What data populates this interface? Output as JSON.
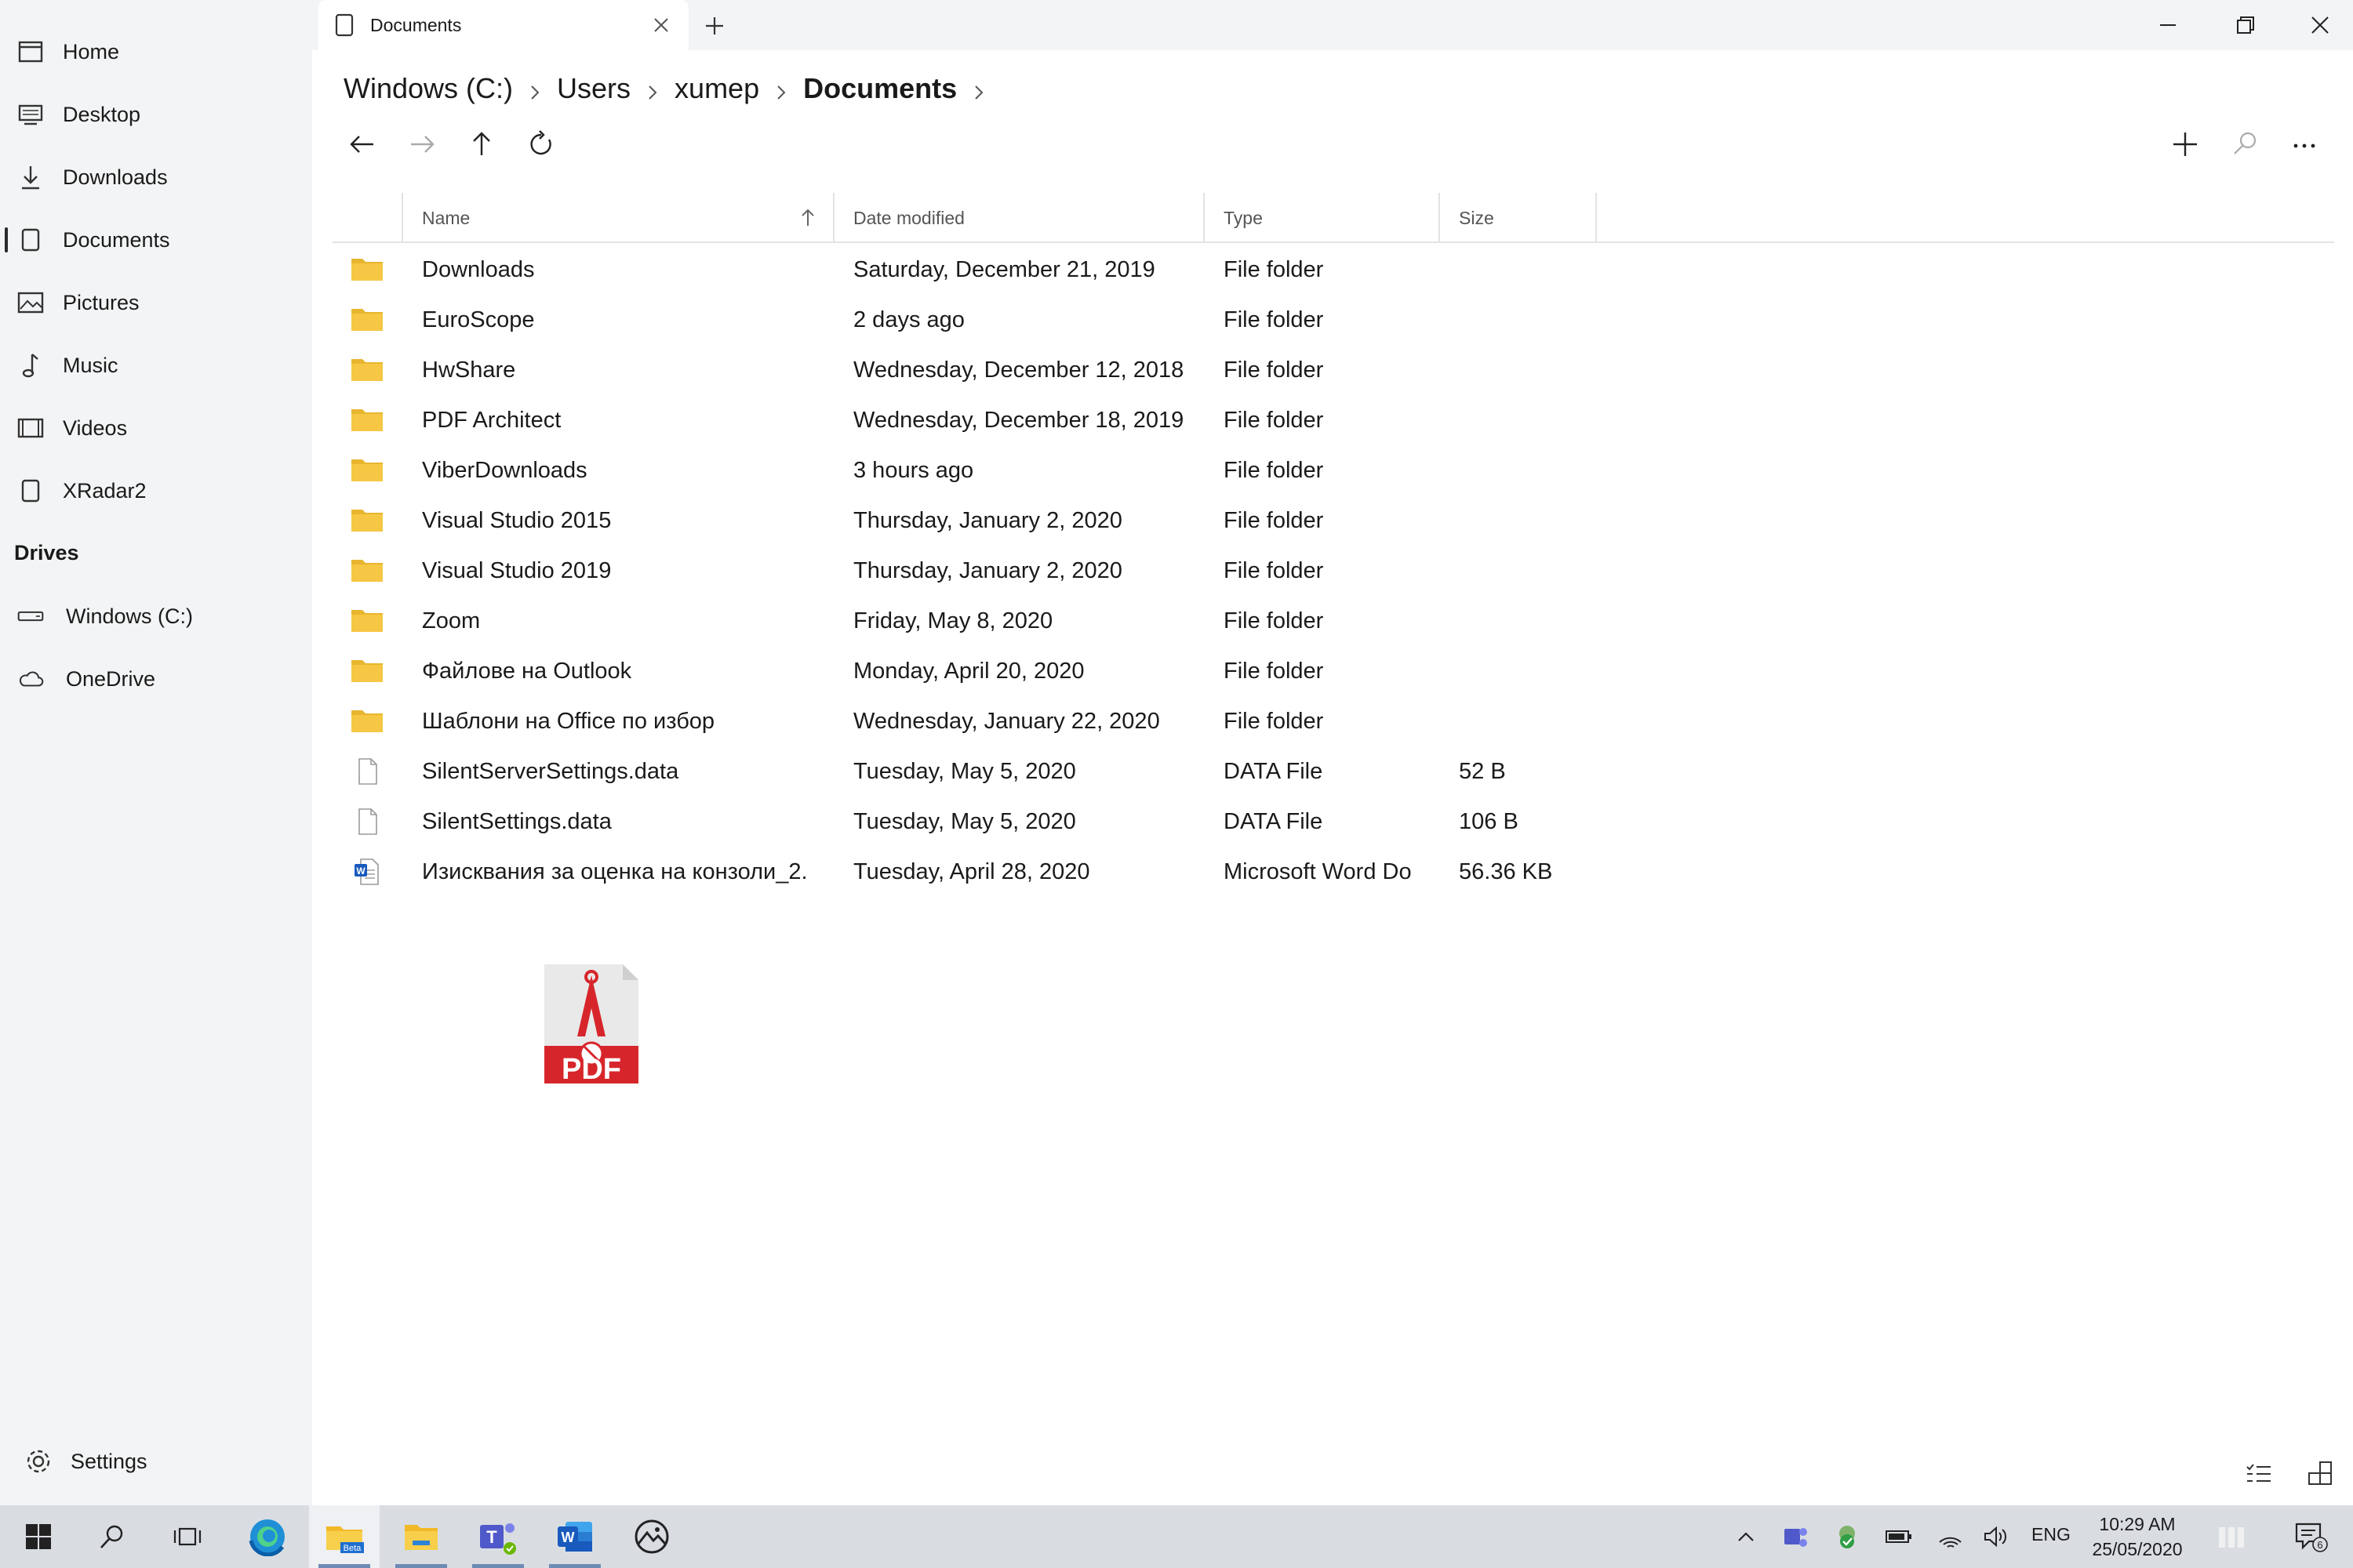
{
  "sidebar": {
    "items": [
      {
        "label": "Home",
        "icon": "home-icon"
      },
      {
        "label": "Desktop",
        "icon": "desktop-icon"
      },
      {
        "label": "Downloads",
        "icon": "download-icon"
      },
      {
        "label": "Documents",
        "icon": "document-icon"
      },
      {
        "label": "Pictures",
        "icon": "picture-icon"
      },
      {
        "label": "Music",
        "icon": "music-icon"
      },
      {
        "label": "Videos",
        "icon": "video-icon"
      },
      {
        "label": "XRadar2",
        "icon": "document-icon"
      }
    ],
    "drives_header": "Drives",
    "drives": [
      {
        "label": "Windows (C:)",
        "icon": "drive-icon"
      },
      {
        "label": "OneDrive",
        "icon": "cloud-icon"
      }
    ],
    "settings_label": "Settings"
  },
  "tab": {
    "title": "Documents"
  },
  "breadcrumb": [
    "Windows (C:)",
    "Users",
    "xumep",
    "Documents"
  ],
  "columns": {
    "name": "Name",
    "date": "Date modified",
    "type": "Type",
    "size": "Size"
  },
  "files": [
    {
      "name": "Downloads",
      "date": "Saturday, December 21, 2019",
      "type": "File folder",
      "size": "",
      "kind": "folder"
    },
    {
      "name": "EuroScope",
      "date": "2 days ago",
      "type": "File folder",
      "size": "",
      "kind": "folder"
    },
    {
      "name": "HwShare",
      "date": "Wednesday, December 12, 2018",
      "type": "File folder",
      "size": "",
      "kind": "folder"
    },
    {
      "name": "PDF Architect",
      "date": "Wednesday, December 18, 2019",
      "type": "File folder",
      "size": "",
      "kind": "folder"
    },
    {
      "name": "ViberDownloads",
      "date": "3 hours ago",
      "type": "File folder",
      "size": "",
      "kind": "folder"
    },
    {
      "name": "Visual Studio 2015",
      "date": "Thursday, January 2, 2020",
      "type": "File folder",
      "size": "",
      "kind": "folder"
    },
    {
      "name": "Visual Studio 2019",
      "date": "Thursday, January 2, 2020",
      "type": "File folder",
      "size": "",
      "kind": "folder"
    },
    {
      "name": "Zoom",
      "date": "Friday, May 8, 2020",
      "type": "File folder",
      "size": "",
      "kind": "folder"
    },
    {
      "name": "Файлове на Outlook",
      "date": "Monday, April 20, 2020",
      "type": "File folder",
      "size": "",
      "kind": "folder"
    },
    {
      "name": "Шаблони на Office по избор",
      "date": "Wednesday, January 22, 2020",
      "type": "File folder",
      "size": "",
      "kind": "folder"
    },
    {
      "name": "SilentServerSettings.data",
      "date": "Tuesday, May 5, 2020",
      "type": "DATA File",
      "size": "52 B",
      "kind": "file"
    },
    {
      "name": "SilentSettings.data",
      "date": "Tuesday, May 5, 2020",
      "type": "DATA File",
      "size": "106 B",
      "kind": "file"
    },
    {
      "name": "Изисквания за оценка на конзоли_2.",
      "date": "Tuesday, April 28, 2020",
      "type": "Microsoft Word Do",
      "size": "56.36 KB",
      "kind": "word"
    }
  ],
  "drag_icon": {
    "text": "PDF",
    "icon": "pdf-architect-icon",
    "color": "#d7262b"
  },
  "taskbar": {
    "apps": [
      "windows-start-icon",
      "search-icon",
      "task-view-icon",
      "edge-icon",
      "files-beta-icon",
      "file-explorer-icon",
      "teams-icon",
      "word-icon",
      "photos-icon"
    ],
    "files_badge": "Beta",
    "lang": "ENG",
    "time": "10:29 AM",
    "date": "25/05/2020",
    "notification_count": "6"
  },
  "colors": {
    "folder": "#f6c744",
    "accent": "#0067c0",
    "sidebar_bg": "#f3f4f5",
    "taskbar_bg": "#d9dde2"
  }
}
